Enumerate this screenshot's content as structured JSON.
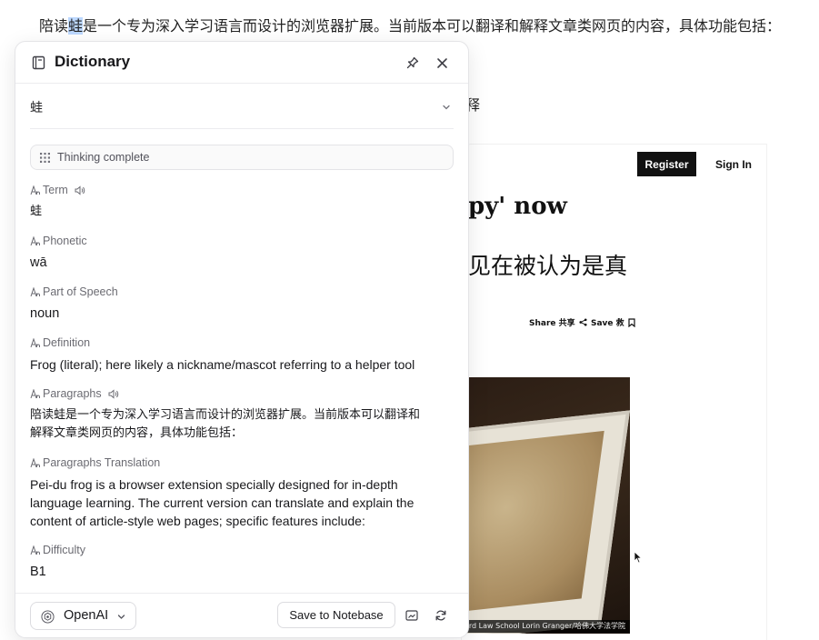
{
  "background": {
    "line1_before": "陪读",
    "line1_highlight": "蛙",
    "line1_after": "是一个专为深入学习语言而设计的浏览器扩展。当前版本可以翻译和解释文章类网页的内容，具体功能包括：",
    "fragment": "释",
    "register_label": "Register",
    "signin_label": "Sign In",
    "headline": "py' now",
    "subhead": "见在被认为是真",
    "share_label": "Share 共享",
    "save_label": "Save 救",
    "photo_caption": "ard Law School Lorin Granger/哈佛大学法学院"
  },
  "panel": {
    "title": "Dictionary",
    "selected_word": "蛙",
    "thinking_label": "Thinking complete",
    "fields": [
      {
        "label": "Term",
        "value": "蛙",
        "speaker": true
      },
      {
        "label": "Phonetic",
        "value": "wā",
        "speaker": false
      },
      {
        "label": "Part of Speech",
        "value": "noun",
        "speaker": false
      },
      {
        "label": "Definition",
        "value": "Frog (literal); here likely a nickname/mascot referring to a helper tool",
        "speaker": false
      },
      {
        "label": "Paragraphs",
        "value_line1": "陪读蛙是一个专为深入学习语言而设计的浏览器扩展。当前版本可以翻译和",
        "value_line2": "解释文章类网页的内容，具体功能包括：",
        "speaker": true
      },
      {
        "label": "Paragraphs Translation",
        "value": "Pei-du frog is a browser extension specially designed for in-depth language learning. The current version can translate and explain the content of article-style web pages; specific features include:",
        "speaker": false
      },
      {
        "label": "Difficulty",
        "value": "B1",
        "speaker": false
      }
    ],
    "footer": {
      "model_label": "OpenAI",
      "save_button_label": "Save to Notebase"
    }
  }
}
